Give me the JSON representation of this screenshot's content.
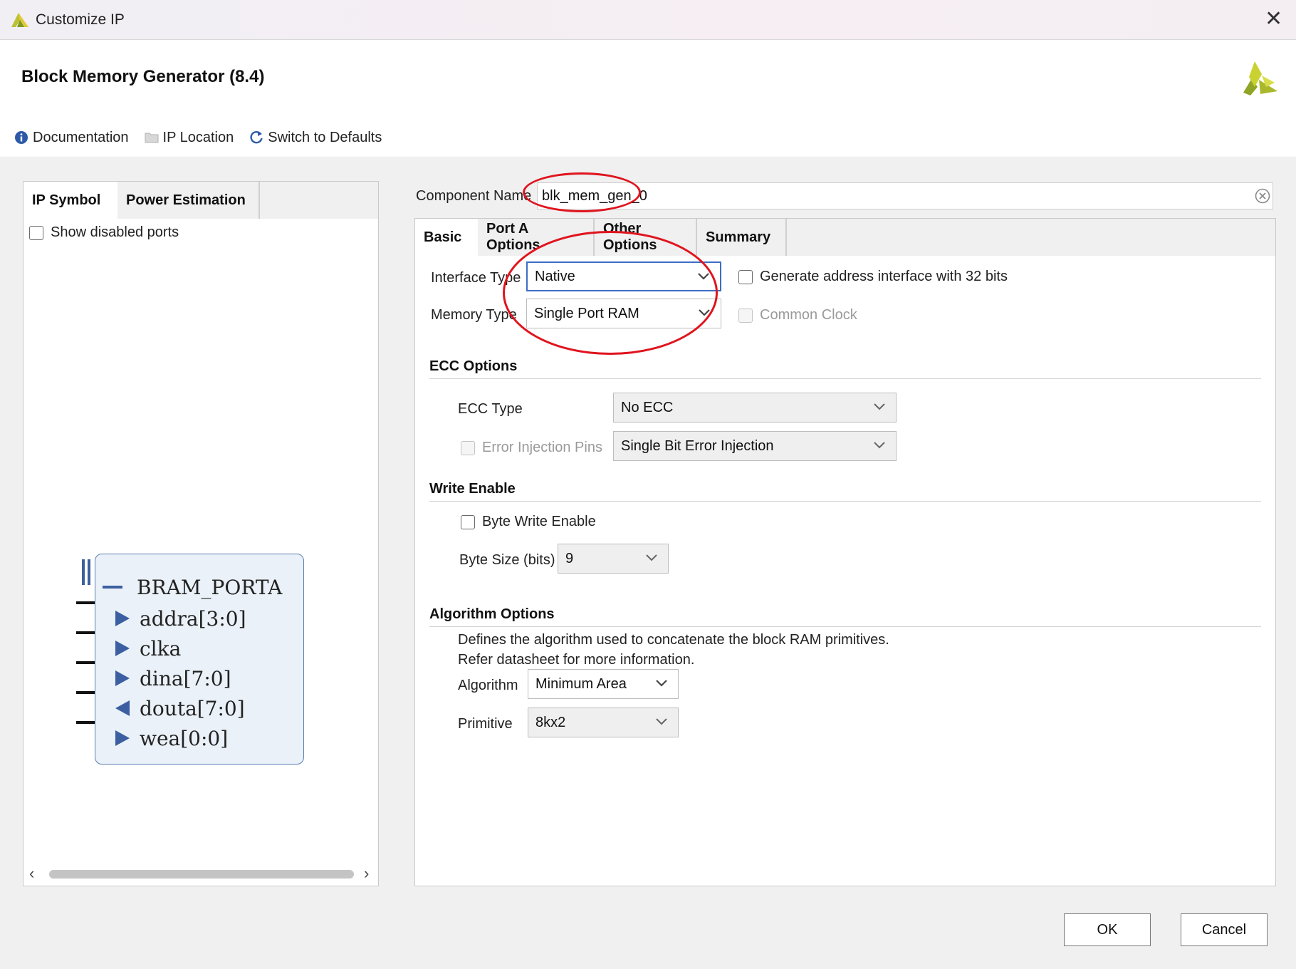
{
  "window": {
    "title": "Customize IP"
  },
  "header": {
    "subtitle": "Block Memory Generator (8.4)"
  },
  "toolbar": {
    "documentation": "Documentation",
    "ip_location": "IP Location",
    "switch_defaults": "Switch to Defaults"
  },
  "left": {
    "tabs": [
      "IP Symbol",
      "Power Estimation"
    ],
    "show_disabled": "Show disabled ports",
    "symbol": {
      "bus": "BRAM_PORTA",
      "pins": [
        "addra[3:0]",
        "clka",
        "dina[7:0]",
        "douta[7:0]",
        "wea[0:0]"
      ],
      "pin_dirs": [
        "in",
        "in",
        "in",
        "out",
        "in"
      ]
    }
  },
  "component": {
    "label": "Component Name",
    "value": "blk_mem_gen_0"
  },
  "tabs": [
    "Basic",
    "Port A Options",
    "Other Options",
    "Summary"
  ],
  "basic": {
    "interface_type_label": "Interface Type",
    "interface_type": "Native",
    "memory_type_label": "Memory Type",
    "memory_type": "Single Port RAM",
    "gen_addr": "Generate address interface with 32 bits",
    "common_clock": "Common Clock"
  },
  "ecc": {
    "header": "ECC Options",
    "type_label": "ECC Type",
    "type": "No ECC",
    "error_pins": "Error Injection Pins",
    "injection": "Single Bit Error Injection"
  },
  "write_enable": {
    "header": "Write Enable",
    "byte_write": "Byte Write Enable",
    "byte_size_label": "Byte Size (bits)",
    "byte_size": "9"
  },
  "algorithm": {
    "header": "Algorithm Options",
    "desc1": "Defines the algorithm used to concatenate the block RAM primitives.",
    "desc2": "Refer datasheet for more information.",
    "algorithm_label": "Algorithm",
    "algorithm": "Minimum Area",
    "primitive_label": "Primitive",
    "primitive": "8kx2"
  },
  "buttons": {
    "ok": "OK",
    "cancel": "Cancel"
  },
  "colors": {
    "annotation": "#e0141e",
    "accent": "#3d6dc4",
    "symbol_fill": "#eaf1f8",
    "logo": "#9aaa2a"
  },
  "icons": [
    "xilinx-logo-icon",
    "close-icon",
    "info-icon",
    "folder-icon",
    "refresh-icon",
    "clear-icon",
    "chevron-down-icon"
  ]
}
